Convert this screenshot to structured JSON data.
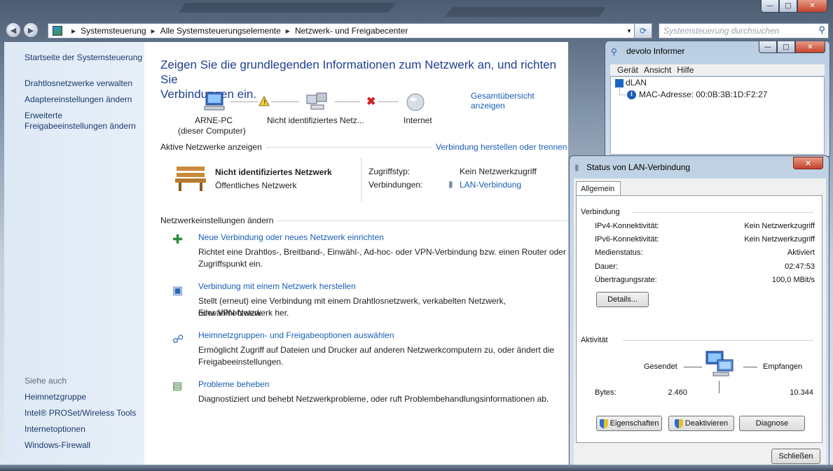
{
  "breadcrumb": [
    "Systemsteuerung",
    "Alle Systemsteuerungselemente",
    "Netzwerk- und Freigabecenter"
  ],
  "search_placeholder": "Systemsteuerung durchsuchen",
  "sidebar": {
    "items": [
      "Startseite der Systemsteuerung",
      "Drahtlosnetzwerke verwalten",
      "Adaptereinstellungen ändern",
      "Erweiterte",
      "Freigabeeinstellungen ändern"
    ],
    "see_also_title": "Siehe auch",
    "see_also": [
      "Heimnetzgruppe",
      "Intel® PROSet/Wireless Tools",
      "Internetoptionen",
      "Windows-Firewall"
    ]
  },
  "main": {
    "headline_line1": "Zeigen Sie die grundlegenden Informationen zum Netzwerk an, und richten Sie",
    "headline_line2": "Verbindungen ein.",
    "overview_link": "Gesamtübersicht anzeigen",
    "map": {
      "computer_name": "ARNE-PC",
      "computer_sub": "(dieser Computer)",
      "network": "Nicht identifiziertes Netz...",
      "internet": "Internet"
    },
    "active_title": "Aktive Netzwerke anzeigen",
    "connect_link": "Verbindung herstellen oder trennen",
    "network_name": "Nicht identifiziertes Netzwerk",
    "network_type": "Öffentliches Netzwerk",
    "access_label": "Zugriffstyp:",
    "access_value": "Kein Netzwerkzugriff",
    "connections_label": "Verbindungen:",
    "connections_value": "LAN-Verbindung",
    "settings_title": "Netzwerkeinstellungen ändern",
    "tasks": [
      {
        "link": "Neue Verbindung oder neues Netzwerk einrichten",
        "desc1": "Richtet eine Drahtlos-, Breitband-, Einwähl-, Ad-hoc- oder VPN-Verbindung bzw. einen Router oder",
        "desc2": "Zugriffspunkt ein."
      },
      {
        "link": "Verbindung mit einem Netzwerk herstellen",
        "desc1": "Stellt (erneut) eine Verbindung mit einem Drahtlosnetzwerk, verkabelten Netzwerk, Einwählnetzwerk",
        "desc2": "oder VPN-Netzwerk her."
      },
      {
        "link": "Heimnetzgruppen- und Freigabeoptionen auswählen",
        "desc1": "Ermöglicht Zugriff auf Dateien und Drucker auf anderen Netzwerkcomputern zu, oder ändert die",
        "desc2": "Freigabeeinstellungen."
      },
      {
        "link": "Probleme beheben",
        "desc1": "Diagnostiziert und behebt Netzwerkprobleme, oder ruft Problembehandlungsinformationen ab.",
        "desc2": ""
      }
    ]
  },
  "devolo": {
    "title": "devolo Informer",
    "menu": [
      "Gerät",
      "Ansicht",
      "Hilfe"
    ],
    "tree_root": "dLAN",
    "tree_child": "MAC-Adresse: 00:0B:3B:1D:F2:27"
  },
  "status": {
    "title": "Status von LAN-Verbindung",
    "tab": "Allgemein",
    "group_connection": "Verbindung",
    "rows": [
      {
        "label": "IPv4-Konnektivität:",
        "value": "Kein Netzwerkzugriff"
      },
      {
        "label": "IPv6-Konnektivität:",
        "value": "Kein Netzwerkzugriff"
      },
      {
        "label": "Medienstatus:",
        "value": "Aktiviert"
      },
      {
        "label": "Dauer:",
        "value": "02:47:53"
      },
      {
        "label": "Übertragungsrate:",
        "value": "100,0 MBit/s"
      }
    ],
    "details_button": "Details...",
    "group_activity": "Aktivität",
    "sent_label": "Gesendet",
    "received_label": "Empfangen",
    "bytes_label": "Bytes:",
    "bytes_sent": "2.460",
    "bytes_received": "10.344",
    "btn_properties": "Eigenschaften",
    "btn_deactivate": "Deaktivieren",
    "btn_diagnose": "Diagnose",
    "btn_close": "Schließen"
  }
}
